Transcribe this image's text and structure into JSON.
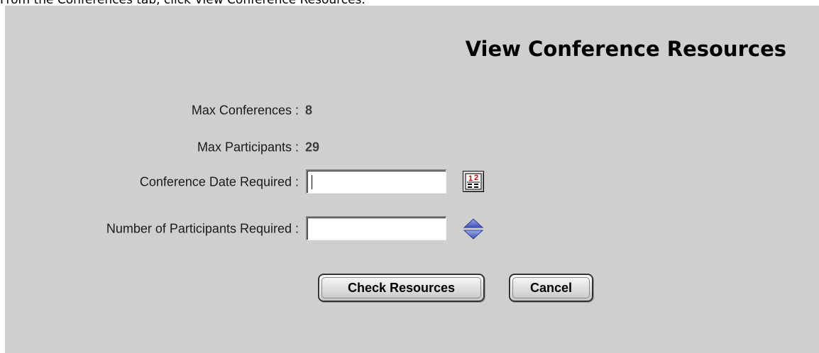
{
  "instruction": "From the Conferences tab, click View Conference Resources.",
  "title": "View Conference Resources",
  "info": {
    "max_conferences_label": "Max Conferences :",
    "max_conferences_value": "8",
    "max_participants_label": "Max Participants :",
    "max_participants_value": "29"
  },
  "form": {
    "date_label": "Conference Date Required :",
    "date_value": "",
    "participants_label": "Number of Participants Required :",
    "participants_value": ""
  },
  "buttons": {
    "check_label": "Check Resources",
    "cancel_label": "Cancel"
  },
  "icons": {
    "calendar": "calendar-icon",
    "spinner": "up-down-spinner-icon"
  },
  "colors": {
    "panel_bg": "#cfcfcf",
    "calendar_red": "#d40000",
    "spinner_blue": "#5b6fc8"
  }
}
